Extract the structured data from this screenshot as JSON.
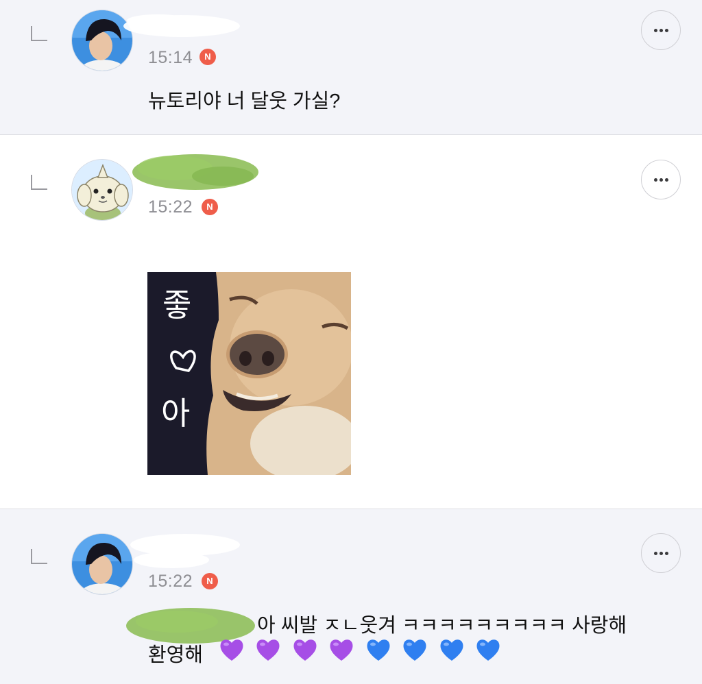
{
  "comments": [
    {
      "time": "15:14",
      "badge": "N",
      "text": "뉴토리야 너 달웃 가실?",
      "more_label": "more-options"
    },
    {
      "time": "15:22",
      "badge": "N",
      "sticker_text": [
        "좋",
        "아"
      ],
      "more_label": "more-options"
    },
    {
      "time": "15:22",
      "badge": "N",
      "text_line1": "아 씨발 ㅈㄴ웃겨 ㅋㅋㅋㅋㅋㅋㅋㅋㅋ 사랑해",
      "text_line2": "환영해",
      "emojis": [
        "purple-heart",
        "purple-heart",
        "purple-heart",
        "purple-heart",
        "blue-heart",
        "blue-heart",
        "blue-heart",
        "blue-heart"
      ],
      "more_label": "more-options"
    }
  ],
  "colors": {
    "badge": "#ef5d4a",
    "reply_bg": "#f3f4f9",
    "redaction_green": "#8fbf5a",
    "purple_heart": "#a64ee6",
    "blue_heart": "#2f7ff0"
  }
}
